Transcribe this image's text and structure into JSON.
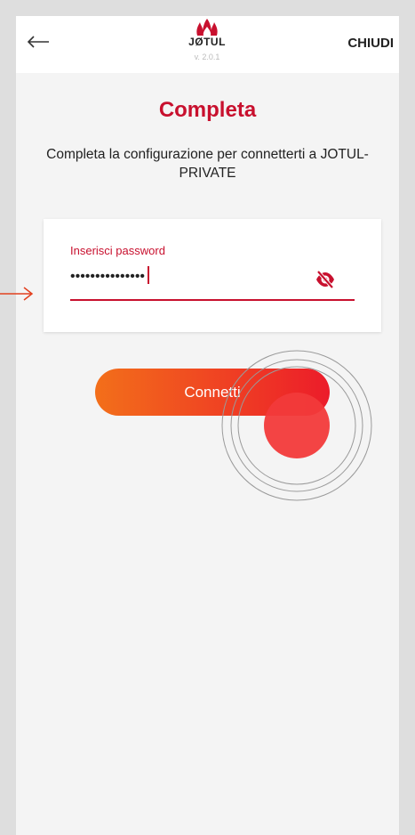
{
  "header": {
    "back_icon": "arrow-left-icon",
    "logo_text": "JØTUL",
    "version": "v. 2.0.1",
    "close_label": "CHIUDI"
  },
  "main": {
    "title": "Completa",
    "subtitle": "Completa la configurazione per connetterti a JOTUL-PRIVATE"
  },
  "password_field": {
    "label": "Inserisci password",
    "value": "•••••••••••••••",
    "toggle_icon": "eye-off-icon"
  },
  "connect_button": {
    "label": "Connetti"
  },
  "colors": {
    "brand_red": "#c8102e",
    "gradient_start": "#f36f1a",
    "gradient_end": "#ec1c2a",
    "touch_indicator": "#f23a3a"
  }
}
